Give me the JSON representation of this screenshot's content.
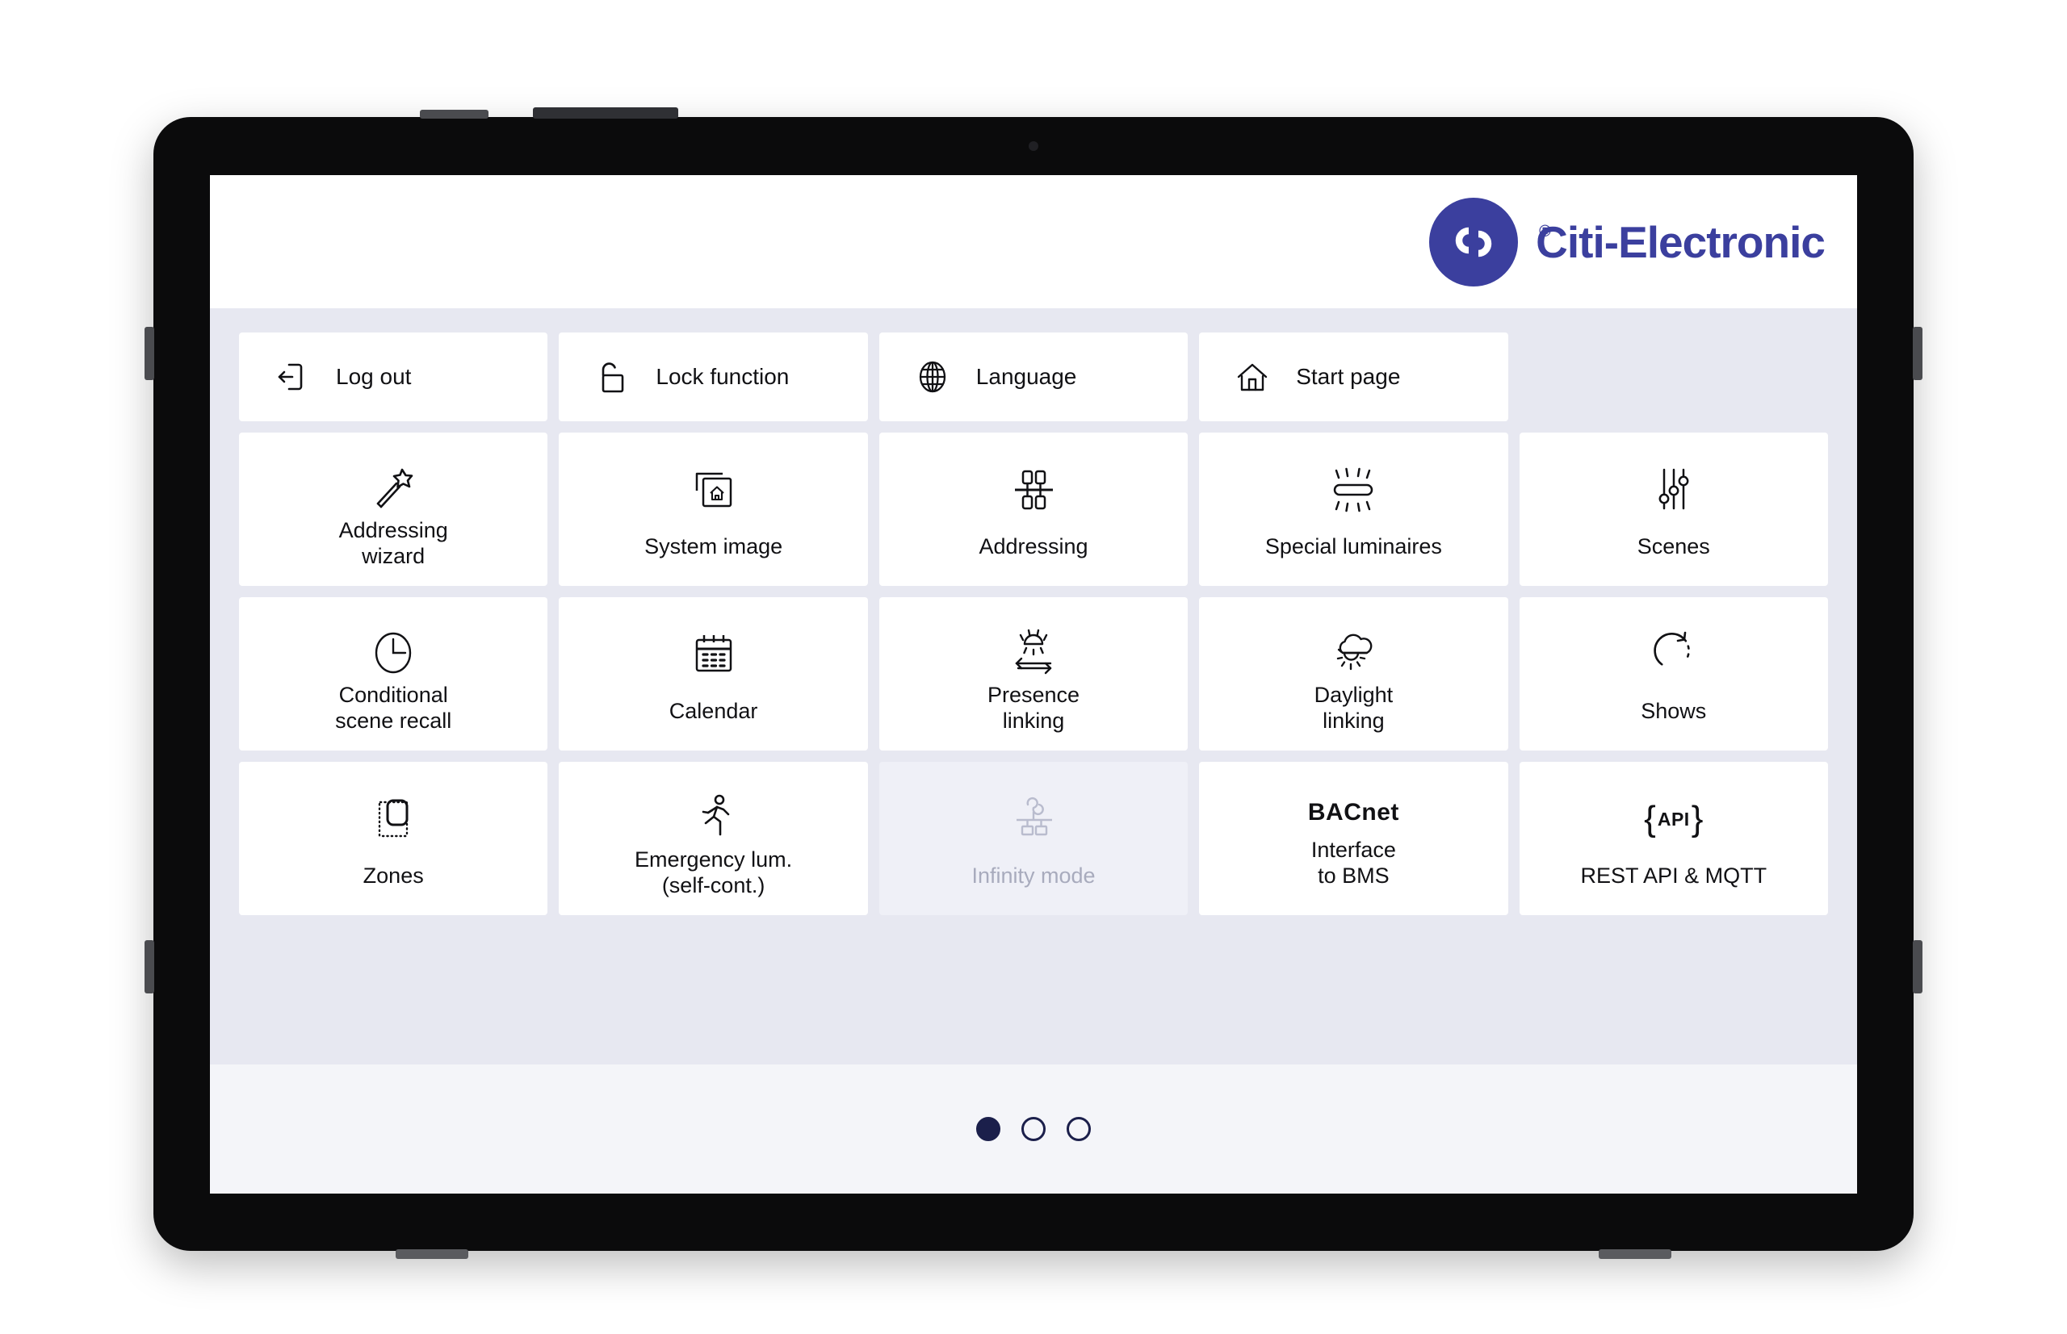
{
  "brand": {
    "name": "Citi-Electronic",
    "registered_mark": "®",
    "logo_color": "#3b3f9e",
    "logo_icon": "double-loop-logo-icon"
  },
  "board": {
    "background_color": "#e7e8f1",
    "rows": [
      {
        "type": "wide",
        "tiles": [
          {
            "label": "Log out",
            "icon": "logout-icon",
            "state": "enabled"
          },
          {
            "label": "Lock function",
            "icon": "open-padlock-icon",
            "state": "enabled"
          },
          {
            "label": "Language",
            "icon": "globe-icon",
            "state": "enabled"
          },
          {
            "label": "Start page",
            "icon": "home-icon",
            "state": "enabled"
          },
          {
            "label": "",
            "icon": "none",
            "state": "empty"
          }
        ]
      },
      {
        "type": "square",
        "tiles": [
          {
            "label": "Addressing\nwizard",
            "icon": "magic-wand-icon",
            "state": "enabled"
          },
          {
            "label": "System image",
            "icon": "framed-house-icon",
            "state": "enabled"
          },
          {
            "label": "Addressing",
            "icon": "bus-topology-icon",
            "state": "enabled"
          },
          {
            "label": "Special luminaires",
            "icon": "glowing-luminaire-icon",
            "state": "enabled"
          },
          {
            "label": "Scenes",
            "icon": "sliders-icon",
            "state": "enabled"
          }
        ]
      },
      {
        "type": "square",
        "tiles": [
          {
            "label": "Conditional\nscene recall",
            "icon": "clock-icon",
            "state": "enabled"
          },
          {
            "label": "Calendar",
            "icon": "calendar-icon",
            "state": "enabled"
          },
          {
            "label": "Presence\nlinking",
            "icon": "presence-sensor-icon",
            "state": "enabled"
          },
          {
            "label": "Daylight\nlinking",
            "icon": "cloud-sun-icon",
            "state": "enabled"
          },
          {
            "label": "Shows",
            "icon": "circular-arrow-icon",
            "state": "enabled"
          }
        ]
      },
      {
        "type": "square",
        "tiles": [
          {
            "label": "Zones",
            "icon": "selection-zone-icon",
            "state": "enabled"
          },
          {
            "label": "Emergency lum.\n(self-cont.)",
            "icon": "running-person-icon",
            "state": "enabled"
          },
          {
            "label": "Infinity mode",
            "icon": "infinity-bus-icon",
            "state": "disabled"
          },
          {
            "label": "Interface\nto BMS",
            "icon": "bacnet-text-icon",
            "icon_text": "BACnet",
            "state": "enabled"
          },
          {
            "label": "REST API & MQTT",
            "icon": "api-braces-icon",
            "icon_text": "API",
            "state": "enabled"
          }
        ]
      }
    ]
  },
  "pager": {
    "total": 3,
    "current": 1,
    "active_color": "#1b1f4b"
  }
}
